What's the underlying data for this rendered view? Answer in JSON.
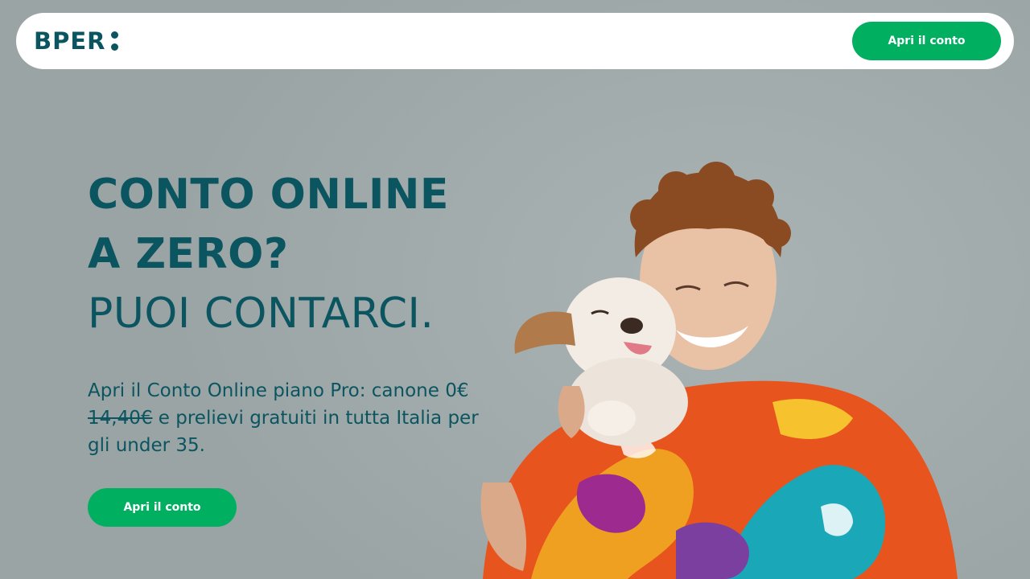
{
  "brand": {
    "name": "BPER",
    "color": "#0b5560",
    "accent": "#00b060"
  },
  "header": {
    "cta_label": "Apri il conto"
  },
  "hero": {
    "headline_line1": "CONTO ONLINE",
    "headline_line2": "A ZERO?",
    "headline_line3": "PUOI CONTARCI.",
    "subtitle_part1": "Apri il Conto Online piano Pro: canone 0€ ",
    "old_price": "14,40€",
    "subtitle_part2": " e prelievi gratuiti in tutta Italia per gli under 35.",
    "cta_label": "Apri il conto"
  },
  "image": {
    "subject": "young man hugging a dog wrapped in a colorful blanket"
  }
}
